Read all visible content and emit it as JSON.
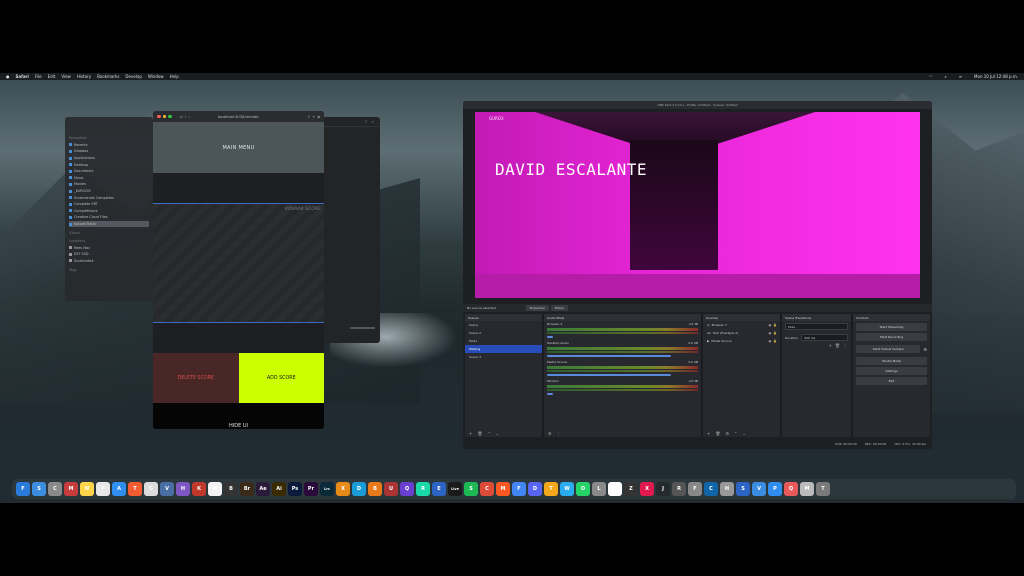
{
  "menubar": {
    "app_name": "Safari",
    "items": [
      "File",
      "Edit",
      "View",
      "History",
      "Bookmarks",
      "Develop",
      "Window",
      "Help"
    ],
    "clock": "Mon 10 Jul 12:48 p.m."
  },
  "finder": {
    "favorites_header": "Favourites",
    "items": [
      "Recents",
      "Dropbox",
      "Applications",
      "Desktop",
      "Documents",
      "Music",
      "Movies",
      "_KURSOIS",
      "Screenshots Completes",
      "Complete SRT",
      "Complétitions",
      "Creative Cloud Files"
    ],
    "selected": "KovaahTrackr",
    "icloud_header": "iCloud",
    "locations_header": "Locations",
    "locations": [
      "Rees Mac",
      "EXT SSD",
      "Scratchdisk"
    ],
    "tags_header": "Tags"
  },
  "browser": {
    "url": "localhost:3030/remote",
    "main_menu": "MAIN MENU",
    "score_title": "KOVAAK SCORE",
    "delete_label": "DELETE SCORE",
    "add_label": "ADD SCORE",
    "hide_label": "HIDE UI",
    "accent_add": "#ccff00",
    "accent_delete": "#d24b4b"
  },
  "obs": {
    "title": "OBS 29.0.3 (mac) - Profile: Untitled - Scenes: Untitled",
    "preview": {
      "logo": "GURO3",
      "overlay_name": "DAVID ESCALANTE"
    },
    "source_bar": {
      "status": "No source selected",
      "properties_label": "Properties",
      "filters_label": "Filters"
    },
    "scenes": {
      "title": "Scenes",
      "items": [
        "Scene",
        "Scene 2",
        "Mode",
        "Waiting",
        "Scene 3"
      ],
      "selected": "Waiting"
    },
    "mixer": {
      "title": "Audio Mixer",
      "channels": [
        {
          "name": "Browser 3",
          "level": "-inf dB"
        },
        {
          "name": "Desktop Audio",
          "level": "0.0 dB"
        },
        {
          "name": "Media Source",
          "level": "0.0 dB"
        },
        {
          "name": "Mic/Aux",
          "level": "-inf dB"
        }
      ]
    },
    "sources": {
      "title": "Sources",
      "items": [
        "Browser 3",
        "Text (FreeType 2)",
        "Media Source"
      ]
    },
    "transitions": {
      "title": "Scene Transitions",
      "type": "Fade",
      "duration_label": "Duration",
      "duration_value": "300 ms"
    },
    "controls": {
      "title": "Controls",
      "buttons": [
        "Start Streaming",
        "Start Recording",
        "Start Virtual Camera",
        "Studio Mode",
        "Settings",
        "Exit"
      ]
    },
    "status": {
      "live": "LIVE: 00:00:00",
      "rec": "REC: 00:00:00",
      "cpu": "CPU: 2.5%, 30.00 fps"
    }
  },
  "dock": {
    "apps": [
      "F",
      "S",
      "C",
      "M",
      "N",
      "P",
      "A",
      "T",
      "G",
      "V",
      "H",
      "K",
      "W",
      "B",
      "Br",
      "Ae",
      "Ai",
      "Ps",
      "Pr",
      "Lrc",
      "X",
      "D",
      "B",
      "U",
      "Q",
      "R",
      "E",
      "Live",
      "S",
      "C",
      "M",
      "F",
      "D",
      "T",
      "W",
      "O",
      "L",
      "T",
      "Z",
      "X",
      "J",
      "R",
      "F",
      "C",
      "H",
      "S",
      "V",
      "P",
      "Q",
      "M",
      "T"
    ],
    "app_colors": [
      "#2a7ad9",
      "#3c8de0",
      "#8a8a8a",
      "#c73d3d",
      "#ffd64a",
      "#e8e8e8",
      "#2f8ef0",
      "#f25c30",
      "#dcdcdc",
      "#4a6fa5",
      "#7e57c2",
      "#c0392b",
      "#f3f3f3",
      "#333333",
      "#3a2a1a",
      "#2a1a3a",
      "#3a2a00",
      "#0a1a3a",
      "#2a0a3a",
      "#0a2a3a",
      "#e68a1a",
      "#1a9cd8",
      "#e87a1a",
      "#a33",
      "#6a3fd0",
      "#1ad8a8",
      "#2c64c4",
      "#1a1a1a",
      "#1db954",
      "#dd4b39",
      "#ff5722",
      "#4285f4",
      "#5865f2",
      "#f2a81a",
      "#2aabee",
      "#25d366",
      "#8a8a8a",
      "#ffffff",
      "#333",
      "#e01a4f",
      "#24292e",
      "#555",
      "#888",
      "#16a",
      "#999",
      "#2c64c4",
      "#3a8de0",
      "#2f8ef0",
      "#e85a5a",
      "#bbbbbb",
      "#7a7a7a"
    ]
  }
}
